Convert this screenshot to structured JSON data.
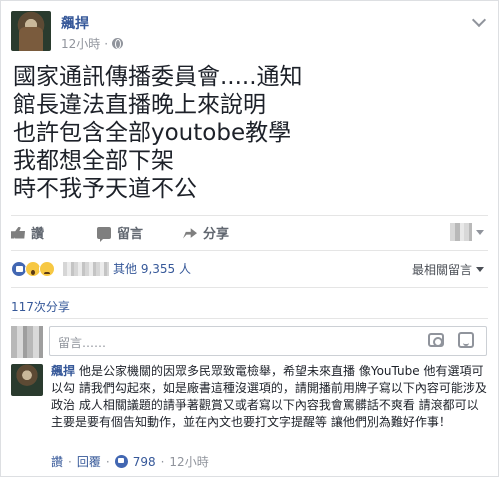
{
  "post": {
    "author": "飆捍",
    "timestamp": "12小時",
    "separator": "·",
    "lines": [
      "國家通訊傳播委員會.....通知",
      "館長違法直播晚上來說明",
      "也許包含全部youtobe教學",
      "我都想全部下架",
      "時不我予天道不公"
    ]
  },
  "actions": {
    "like_label": "讚",
    "comment_label": "留言",
    "share_label": "分享"
  },
  "reactions": {
    "others_text": "其他 9,355 人",
    "sort_label": "最相關留言"
  },
  "shares": {
    "count_text": "117次分享"
  },
  "composer": {
    "placeholder": "留言……"
  },
  "comment": {
    "author": "飆捍",
    "text": "他是公家機關的因眾多民眾致電檢舉，希望未來直播 像YouTube 他有選項可以勾 請我們勾起來，如是廠書這種沒選項的，請開播前用牌子寫以下內容可能涉及政治 成人相關議題的請爭著觀賞又或者寫以下內容我會罵髒話不爽看 請滾都可以 主要是要有個告知動作，並在內文也要打文字提醒等 讓他們別為難好作事！",
    "like_label": "讚",
    "reply_label": "回覆",
    "like_count": "798",
    "time": "12小時",
    "dot": "·"
  },
  "icons": [
    "globe-icon",
    "chevron-down-icon",
    "like-icon",
    "comment-icon",
    "share-icon",
    "camera-icon",
    "sticker-icon",
    "like-react-icon",
    "wow-react-icon",
    "sad-react-icon"
  ],
  "colors": {
    "link": "#365899",
    "muted": "#90949c",
    "text": "#1d2129",
    "like_blue": "#4267b2"
  }
}
